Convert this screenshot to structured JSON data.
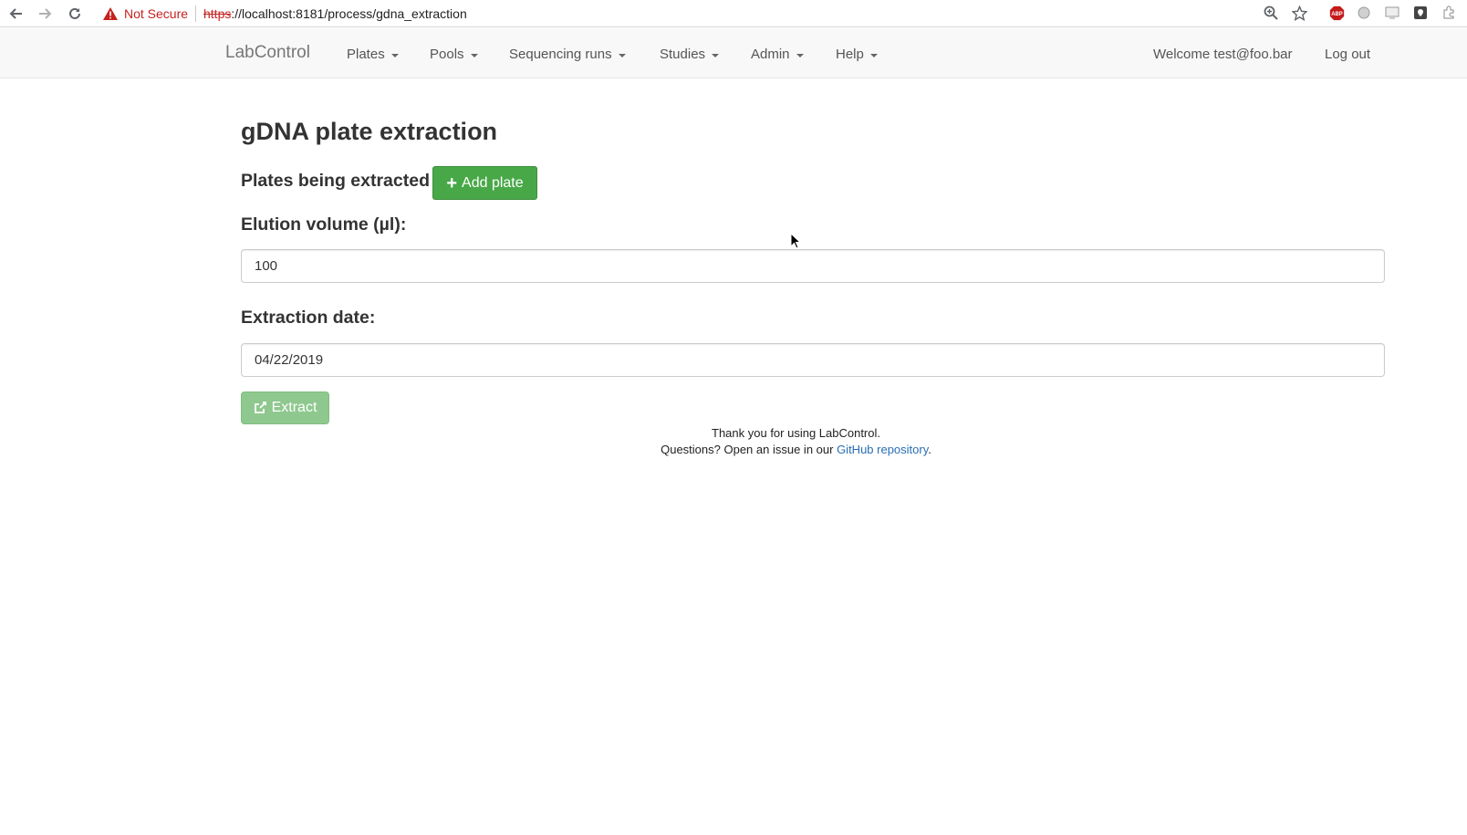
{
  "browser": {
    "security_label": "Not Secure",
    "url_scheme": "https",
    "url_rest": "://localhost:8181/process/gdna_extraction"
  },
  "navbar": {
    "brand": "LabControl",
    "menus": [
      "Plates",
      "Pools",
      "Sequencing runs",
      "Studies",
      "Admin",
      "Help"
    ],
    "welcome": "Welcome test@foo.bar",
    "logout": "Log out"
  },
  "page": {
    "title": "gDNA plate extraction",
    "plates_label": "Plates being extracted",
    "add_plate_label": "Add plate",
    "elution_label": "Elution volume (µl):",
    "elution_value": "100",
    "date_label": "Extraction date:",
    "date_value": "04/22/2019",
    "extract_label": "Extract"
  },
  "footer": {
    "line1": "Thank you for using LabControl.",
    "line2_prefix": "Questions? Open an issue in our ",
    "link_text": "GitHub repository",
    "line2_suffix": "."
  },
  "colors": {
    "success": "#48a848",
    "success_disabled": "#8ec88e",
    "link": "#2a6eb4",
    "warning_red": "#c5221f"
  },
  "icons": [
    "back-arrow-icon",
    "forward-arrow-icon",
    "reload-icon",
    "warning-triangle-icon",
    "zoom-icon",
    "star-icon",
    "adblock-icon",
    "plus-icon",
    "share-icon"
  ]
}
